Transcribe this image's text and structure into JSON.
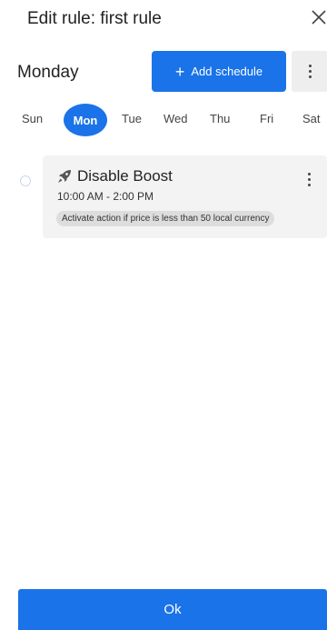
{
  "header": {
    "title": "Edit rule: first rule"
  },
  "schedule": {
    "day_title": "Monday",
    "add_label": "+ Add schedule",
    "add_text": "Add schedule",
    "add_symbol": "+"
  },
  "weekdays": {
    "sun": "Sun",
    "mon": "Mon",
    "tue": "Tue",
    "wed": "Wed",
    "thu": "Thu",
    "fri": "Fri",
    "sat": "Sat",
    "selected": "Mon"
  },
  "rule_card": {
    "icon": "rocket-icon",
    "title": "Disable Boost",
    "time": "10:00 AM - 2:00 PM",
    "condition": "Activate action if price is less than 50 local currency"
  },
  "footer": {
    "ok_label": "Ok"
  },
  "colors": {
    "accent": "#1a73e8",
    "card_bg": "#f3f3f3",
    "chip_bg": "#dddddd"
  }
}
